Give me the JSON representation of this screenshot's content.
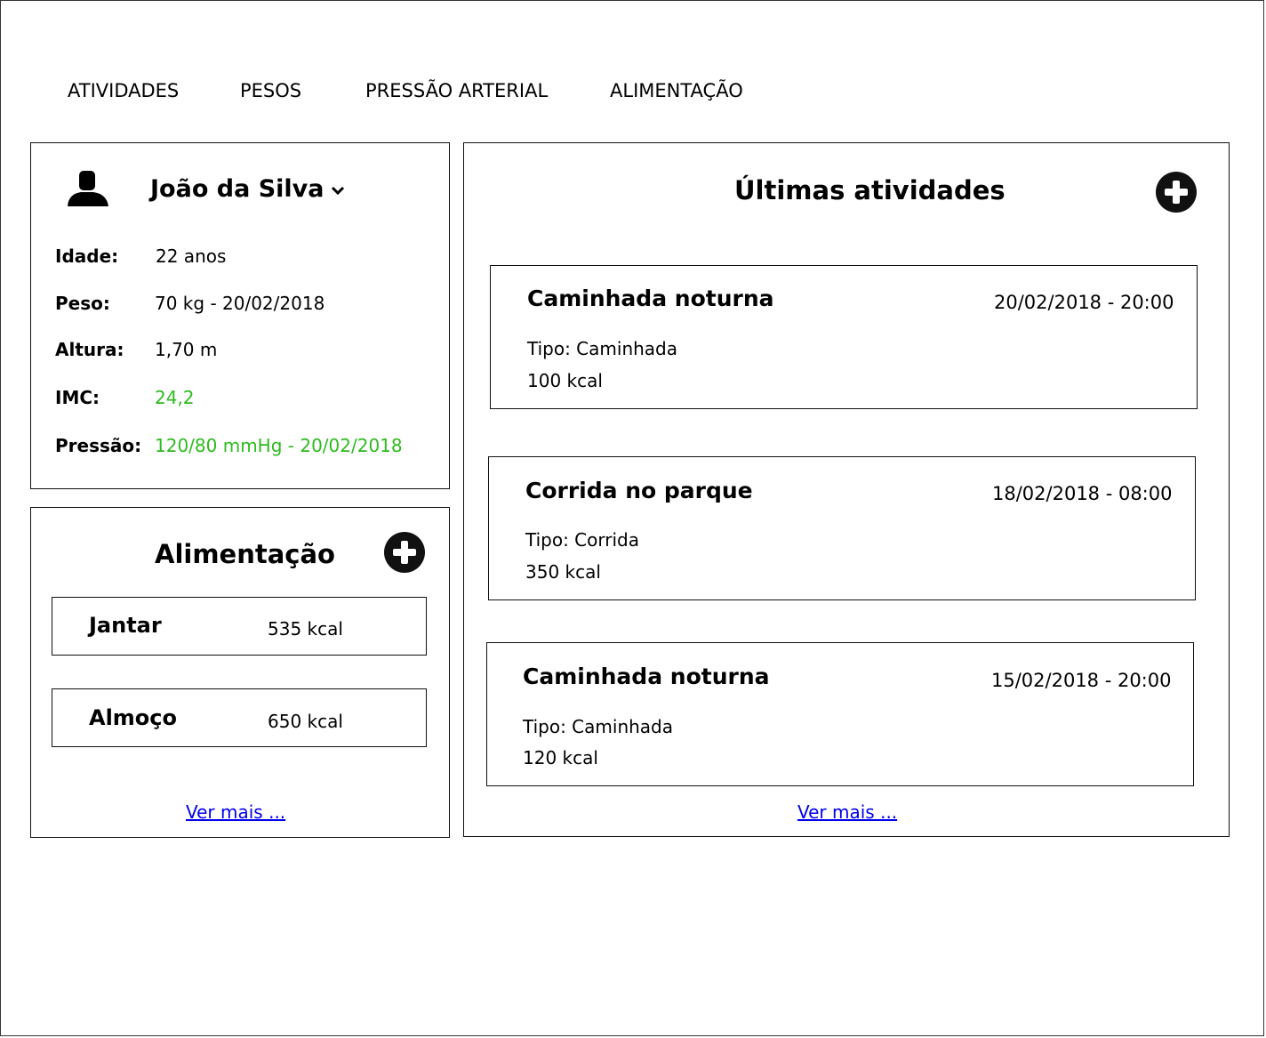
{
  "nav": {
    "items": [
      "ATIVIDADES",
      "PESOS",
      "PRESSÃO ARTERIAL",
      "ALIMENTAÇÃO"
    ]
  },
  "profile": {
    "name": "João da Silva",
    "rows": [
      {
        "label": "Idade:",
        "value": "22 anos"
      },
      {
        "label": "Peso:",
        "value": "70 kg - 20/02/2018"
      },
      {
        "label": "Altura:",
        "value": "1,70 m"
      },
      {
        "label": "IMC:",
        "value": "24,2"
      },
      {
        "label": "Pressão:",
        "value": "120/80 mmHg - 20/02/2018"
      }
    ],
    "highlight_color": "#2dbb1f",
    "avatar_icon": "user-silhouette-icon",
    "dropdown_icon": "chevron-down-icon"
  },
  "food": {
    "title": "Alimentação",
    "add_icon": "plus-circle-icon",
    "items": [
      {
        "name": "Jantar",
        "kcal": "535 kcal"
      },
      {
        "name": "Almoço",
        "kcal": "650 kcal"
      }
    ],
    "more_link": "Ver mais ..."
  },
  "activities": {
    "title": "Últimas atividades",
    "add_icon": "plus-circle-icon",
    "items": [
      {
        "title": "Caminhada noturna",
        "date": "20/02/2018 - 20:00",
        "type": "Tipo: Caminhada",
        "kcal": "100 kcal"
      },
      {
        "title": "Corrida no parque",
        "date": "18/02/2018 - 08:00",
        "type": "Tipo: Corrida",
        "kcal": "350 kcal"
      },
      {
        "title": "Caminhada noturna",
        "date": "15/02/2018 - 20:00",
        "type": "Tipo: Caminhada",
        "kcal": "120 kcal"
      }
    ],
    "more_link": "Ver mais ..."
  }
}
